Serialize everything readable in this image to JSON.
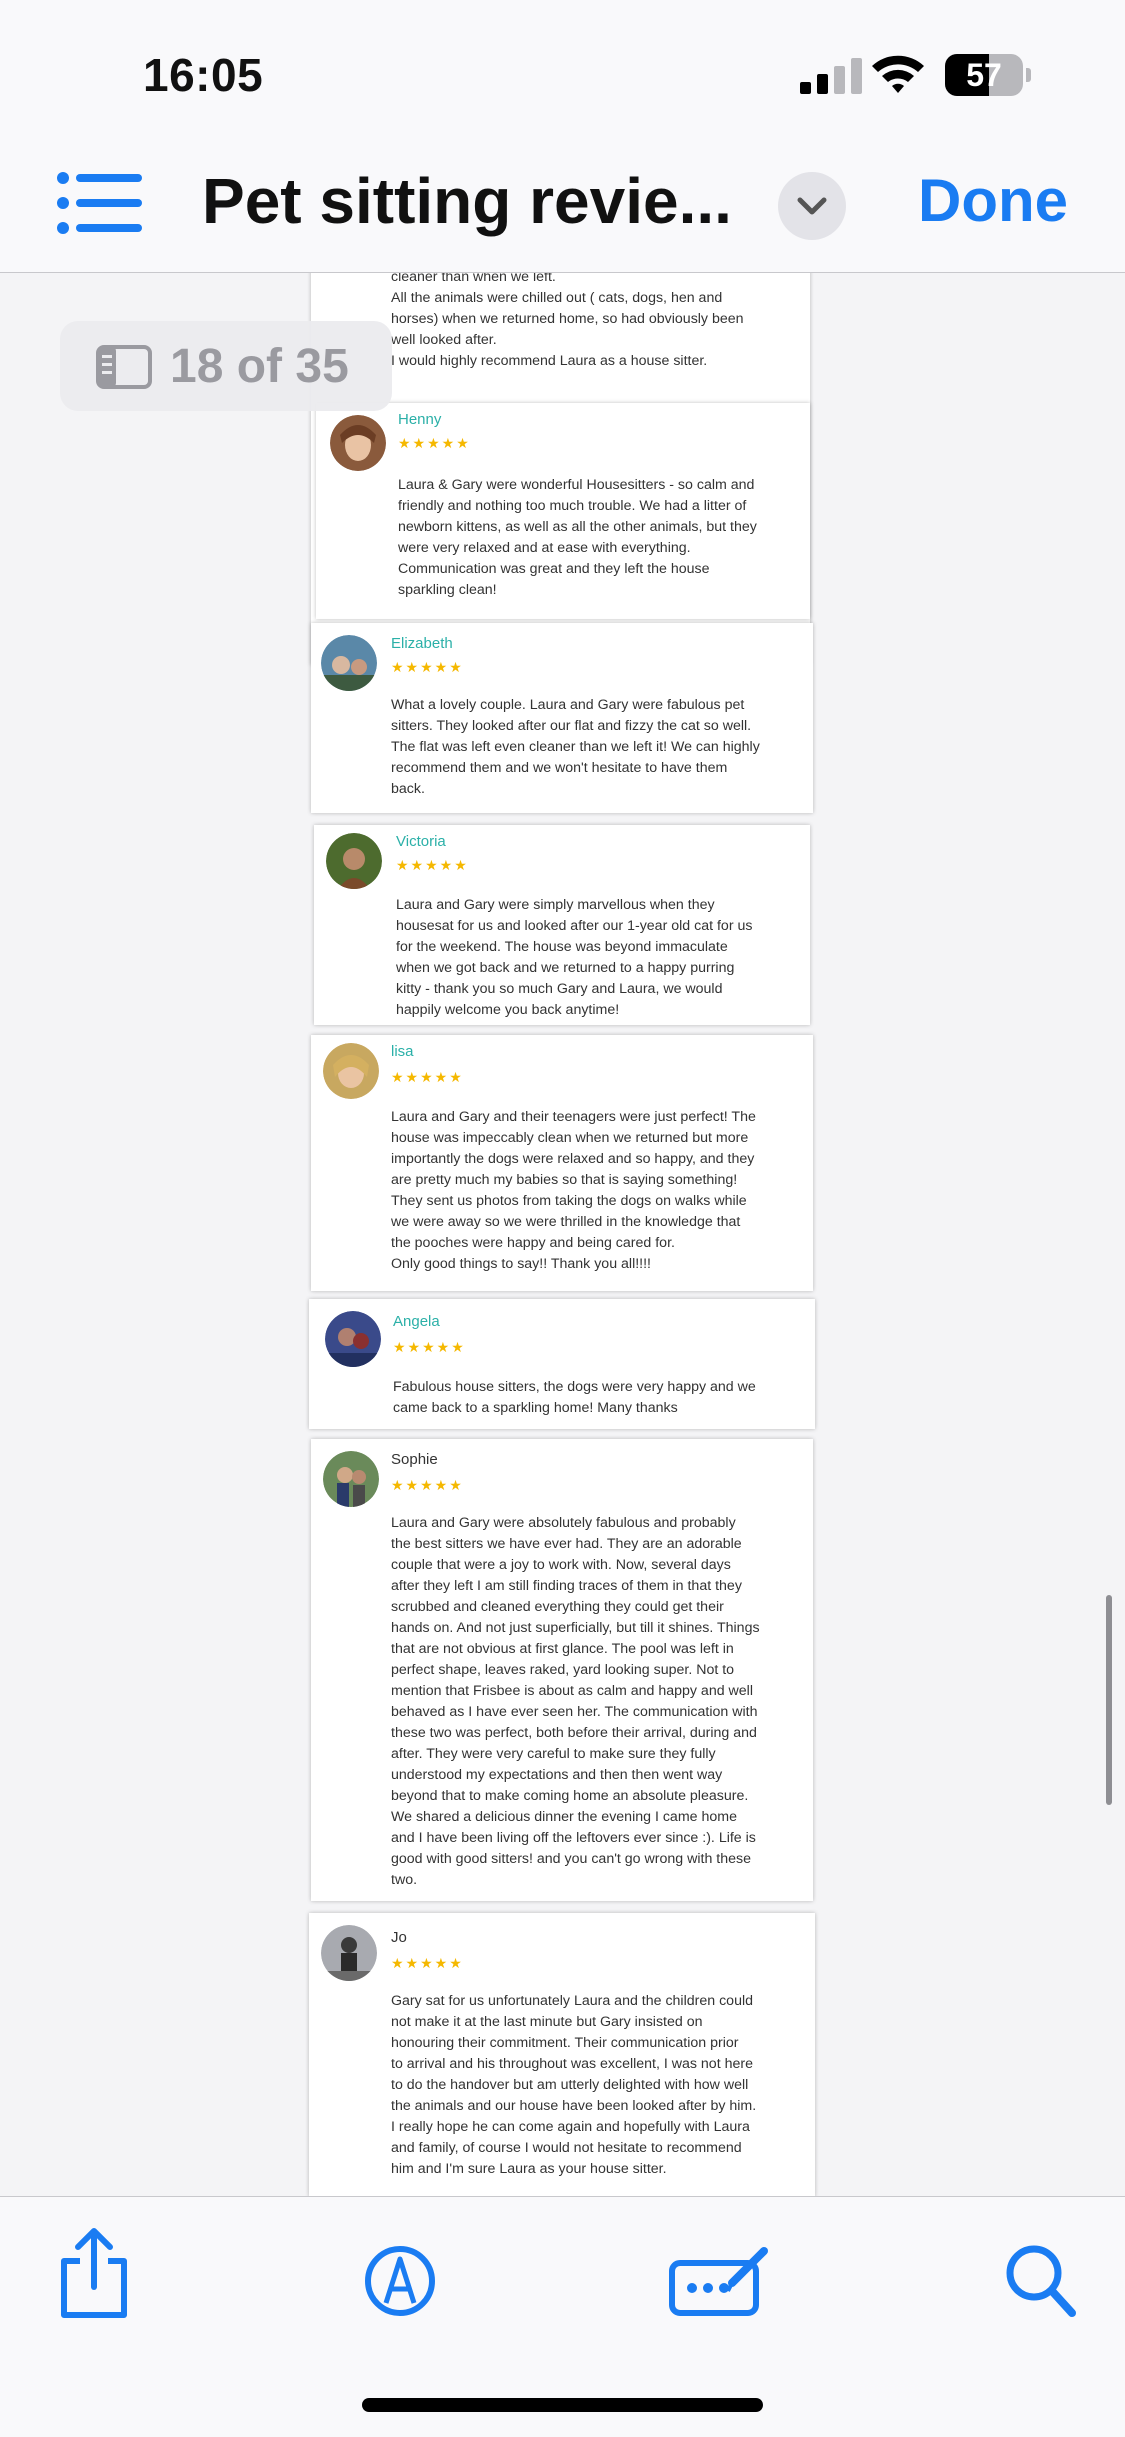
{
  "status_bar": {
    "time": "16:05",
    "battery": "57",
    "battery_level": 0.57
  },
  "nav": {
    "title": "Pet sitting revie...",
    "done_label": "Done"
  },
  "page_indicator": {
    "text": "18 of 35"
  },
  "stars": "★★★★★",
  "colors": {
    "accent": "#1a7cf2",
    "reviewer_name": "#2bb0a8",
    "star": "#f5b800"
  },
  "reviews": [
    {
      "name": "",
      "text": "cleaner than when we left.\nAll the animals were chilled out ( cats, dogs, hen and\nhorses) when we returned home, so had obviously been\nwell looked after.\nI would highly recommend Laura as a house sitter."
    },
    {
      "name": "Henny",
      "text": "Laura & Gary were wonderful Housesitters - so calm and\nfriendly and nothing too much trouble. We had a litter of\nnewborn kittens, as well as all the other animals, but they\nwere very relaxed and at ease with everything.\nCommunication was great and they left the house\nsparkling clean!"
    },
    {
      "name": "Elizabeth",
      "text": "What a lovely couple. Laura and Gary were fabulous pet\nsitters. They looked after our flat and fizzy the cat so well.\nThe flat was left even cleaner than we left it! We can highly\nrecommend them and we won't hesitate to have them\nback."
    },
    {
      "name": "Victoria",
      "text": "Laura and Gary were simply marvellous when they\nhousesat for us and looked after our 1-year old cat for us\nfor the weekend. The house was beyond immaculate\nwhen we got back and we returned to a happy purring\nkitty - thank you so much Gary and Laura, we would\nhappily welcome you back anytime!"
    },
    {
      "name": "lisa",
      "text": "Laura and Gary and their teenagers were just perfect! The\nhouse was impeccably clean when we returned but more\nimportantly the dogs were relaxed and so happy, and they\nare pretty much my babies so that is saying something!\nThey sent us photos from taking the dogs on walks while\nwe were away so we were thrilled in the knowledge that\nthe pooches were happy and being cared for.\nOnly good things to say!! Thank you all!!!!"
    },
    {
      "name": "Angela",
      "text": "Fabulous house sitters, the dogs were very happy and we\ncame back to a sparkling home! Many thanks"
    },
    {
      "name": "Sophie",
      "text": "Laura and Gary were absolutely fabulous and probably\nthe best sitters we have ever had. They are an adorable\ncouple that were a joy to work with. Now, several days\nafter they left I am still finding traces of them in that they\nscrubbed and cleaned everything they could get their\nhands on. And not just superficially, but till it shines. Things\nthat are not obvious at first glance. The pool was left in\nperfect shape, leaves raked, yard looking super. Not to\nmention that Frisbee is about as calm and happy and well\nbehaved as I have ever seen her. The communication with\nthese two was perfect, both before their arrival, during and\nafter. They were very careful to make sure they fully\nunderstood my expectations and then then went way\nbeyond that to make coming home an absolute pleasure.\nWe shared a delicious dinner the evening I came home\nand I have been living off the leftovers ever since :). Life is\ngood with good sitters! and you can't go wrong with these\ntwo."
    },
    {
      "name": "Jo",
      "text": "Gary sat for us unfortunately Laura and the children could\nnot make it at the last minute but Gary insisted on\nhonouring their commitment. Their communication prior\nto arrival and his throughout was excellent, I was not here\nto do the handover but am utterly delighted with how well\nthe animals and our house have been looked after by him.\nI really hope he can come again and hopefully with Laura\nand family, of course I would not hesitate to recommend\nhim and I'm sure Laura as your house sitter."
    }
  ],
  "toolbar": {
    "icons": [
      "share-icon",
      "markup-icon",
      "form-fill-icon",
      "search-icon"
    ]
  }
}
